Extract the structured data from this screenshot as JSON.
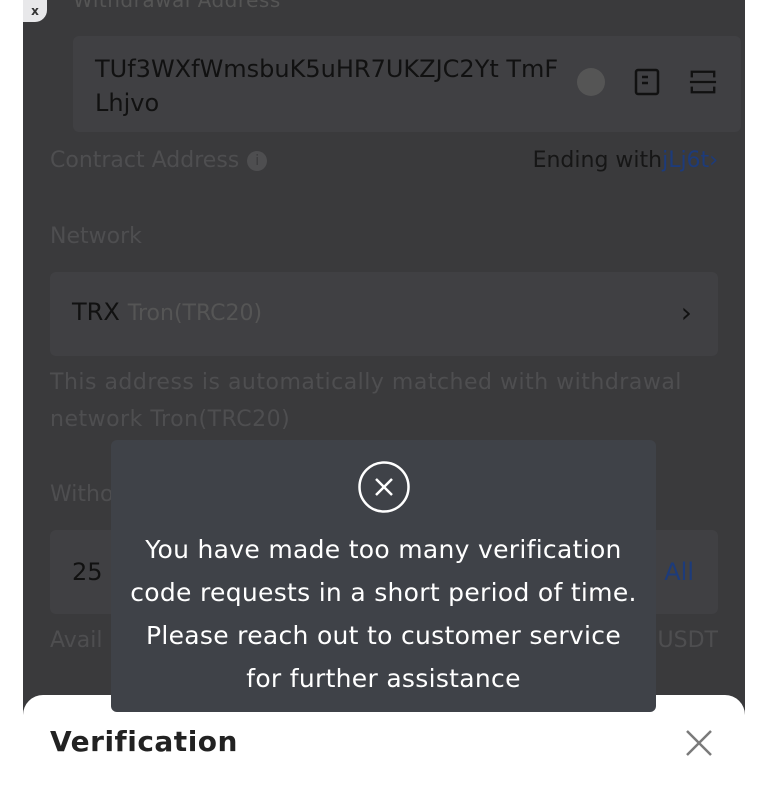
{
  "header": {
    "address_label": "Withdrawal Address",
    "close_icon": "x"
  },
  "address": {
    "value": "TUf3WXfWmsbuK5uHR7UKZJC2Yt TmFLhjvo",
    "icons": [
      "clear-icon",
      "address-book-icon",
      "scan-icon"
    ]
  },
  "contract": {
    "label": "Contract Address",
    "ending_prefix": "Ending with",
    "ending_value": "jLj6t",
    "chevron": "›"
  },
  "network": {
    "label": "Network",
    "symbol": "TRX",
    "name": "Tron(TRC20)",
    "chevron": "›",
    "hint": "This address is automatically matched with withdrawal network Tron(TRC20)"
  },
  "amount": {
    "label": "Witho",
    "value": "25",
    "all_label": "All"
  },
  "available": {
    "label": "Avail",
    "unit": "USDT"
  },
  "sheet": {
    "title": "Verification"
  },
  "toast": {
    "message": "You have made too many verification code requests in a short period of time. Please reach out to customer service for further assistance"
  },
  "colors": {
    "overlay": "#3a3a3c",
    "toast_bg": "#3f4248",
    "link": "#1d3b7a"
  }
}
